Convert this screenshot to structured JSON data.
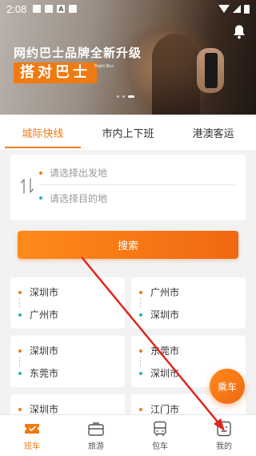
{
  "status_bar": {
    "time": "2:08"
  },
  "banner": {
    "title": "网约巴士品牌全新升级",
    "subtitle": "搭对巴士",
    "tag": "Right Bus"
  },
  "tabs": [
    {
      "label": "城际快线",
      "active": true
    },
    {
      "label": "市内上下班",
      "active": false
    },
    {
      "label": "港澳客运",
      "active": false
    }
  ],
  "route": {
    "from_placeholder": "请选择出发地",
    "to_placeholder": "请选择目的地"
  },
  "search_label": "搜索",
  "lines": [
    {
      "from": "深圳市",
      "to": "广州市"
    },
    {
      "from": "广州市",
      "to": "深圳市"
    },
    {
      "from": "深圳市",
      "to": "东莞市"
    },
    {
      "from": "东莞市",
      "to": "深圳市"
    },
    {
      "from": "深圳市",
      "to": ""
    },
    {
      "from": "江门市",
      "to": ""
    }
  ],
  "fab_label": "乘车",
  "bottom_nav": [
    {
      "label": "班车",
      "active": true
    },
    {
      "label": "旅游",
      "active": false
    },
    {
      "label": "包车",
      "active": false
    },
    {
      "label": "我的",
      "active": false
    }
  ],
  "colors": {
    "accent": "#f07a12",
    "teal": "#25b6b0",
    "annotation": "#e0261c"
  }
}
